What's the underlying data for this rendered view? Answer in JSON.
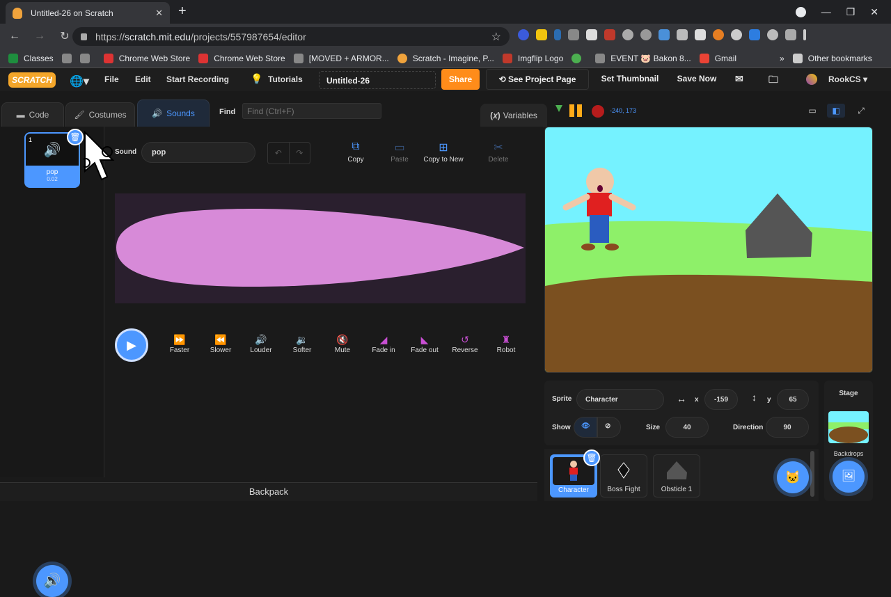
{
  "browser": {
    "tab_title": "Untitled-26 on Scratch",
    "url_host": "scratch.mit.edu",
    "url_path": "/projects/557987654/editor",
    "url_scheme": "https://",
    "bookmarks": [
      "Classes",
      "Chrome Web Store",
      "Chrome Web Store",
      "[MOVED + ARMOR...",
      "Scratch - Imagine, P...",
      "Imgflip Logo",
      "EVENT 🐷 Bakon 8...",
      "Gmail"
    ],
    "other_bookmarks": "Other bookmarks"
  },
  "menubar": {
    "logo": "SCRATCH",
    "file": "File",
    "edit": "Edit",
    "start_recording": "Start Recording",
    "tutorials": "Tutorials",
    "project_title": "Untitled-26",
    "share": "Share",
    "see_project_page": "See Project Page",
    "set_thumbnail": "Set Thumbnail",
    "save_now": "Save Now",
    "username": "RookCS"
  },
  "tabs": {
    "code": "Code",
    "costumes": "Costumes",
    "sounds": "Sounds",
    "find_label": "Find",
    "find_placeholder": "Find (Ctrl+F)",
    "variables": "Variables"
  },
  "sound_list": {
    "item": {
      "index": "1",
      "name": "pop",
      "duration": "0.02"
    }
  },
  "sound_editor": {
    "sound_label": "Sound",
    "sound_name": "pop",
    "tools": [
      "Copy",
      "Paste",
      "Copy to New",
      "Delete"
    ],
    "effects": [
      "Faster",
      "Slower",
      "Louder",
      "Softer",
      "Mute",
      "Fade in",
      "Fade out",
      "Reverse",
      "Robot"
    ]
  },
  "backpack": "Backpack",
  "stage_header": {
    "coords": "-240, 173"
  },
  "sprite_info": {
    "sprite_label": "Sprite",
    "sprite_name": "Character",
    "x_label": "x",
    "x_value": "-159",
    "y_label": "y",
    "y_value": "65",
    "show_label": "Show",
    "size_label": "Size",
    "size_value": "40",
    "direction_label": "Direction",
    "direction_value": "90"
  },
  "sprites": [
    "Character",
    "Boss Fight",
    "Obsticle 1"
  ],
  "stage_panel": {
    "label": "Stage",
    "backdrops": "Backdrops"
  },
  "colors": {
    "accent": "#4c97ff",
    "share": "#ff8c1a",
    "effect": "#c94fd4",
    "waveform": "#d78ad8"
  }
}
